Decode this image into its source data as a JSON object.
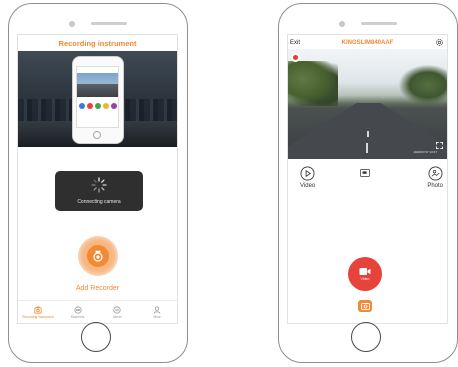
{
  "phone1": {
    "title": "Recording instrument",
    "toast_text": "Connecting camera",
    "add_label": "Add Recorder",
    "nav": [
      {
        "label": "Recording instrument",
        "icon": "recorder-icon",
        "active": true
      },
      {
        "label": "Moments",
        "icon": "moments-icon",
        "active": false
      },
      {
        "label": "Album",
        "icon": "album-icon",
        "active": false
      },
      {
        "label": "Mine",
        "icon": "person-icon",
        "active": false
      }
    ]
  },
  "phone2": {
    "exit_label": "Exit",
    "device_name": "KINGSLIM840AAF",
    "timestamp": "2020/07/17 13:47",
    "actions": {
      "video_label": "Video",
      "photo_label": "Photo"
    },
    "record_button_label": "Video"
  },
  "colors": {
    "accent": "#f08a35",
    "record": "#e8433b"
  }
}
